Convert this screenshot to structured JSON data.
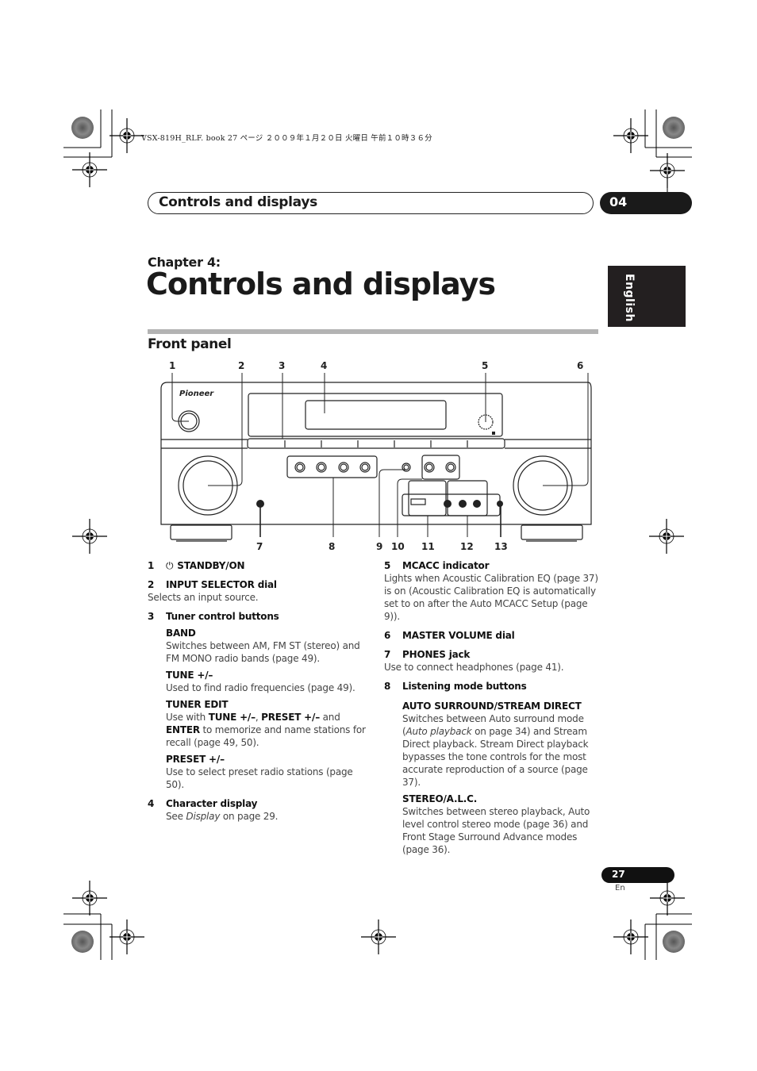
{
  "print_slug": "VSX-819H_RLF. book   27 ページ   ２００９年１月２０日   火曜日   午前１０時３６分",
  "header": {
    "title": "Controls and displays",
    "chapter_number": "04"
  },
  "language_tab": "English",
  "chapter": {
    "label": "Chapter 4:",
    "title": "Controls and displays"
  },
  "section": {
    "title": "Front panel"
  },
  "diagram": {
    "brand_logo": "Pioneer",
    "callouts_top": [
      "1",
      "2",
      "3",
      "4",
      "5",
      "6"
    ],
    "callouts_bottom": [
      "7",
      "8",
      "9",
      "10",
      "11",
      "12",
      "13"
    ]
  },
  "left_column": {
    "items": [
      {
        "num": "1",
        "icon": "power-icon",
        "glyph": "⏻",
        "title": "STANDBY/ON"
      },
      {
        "num": "2",
        "title": "INPUT SELECTOR dial",
        "desc": "Selects an input source."
      },
      {
        "num": "3",
        "title": "Tuner control buttons"
      }
    ],
    "tuner_subitems": [
      {
        "title": "BAND",
        "desc": "Switches between AM, FM ST (stereo) and FM MONO radio bands (page 49)."
      },
      {
        "title": "TUNE +/–",
        "desc": "Used to find radio frequencies (page 49)."
      },
      {
        "title": "TUNER EDIT",
        "desc_parts": {
          "p1": "Use with ",
          "b1": "TUNE +/–",
          "p2": ", ",
          "b2": "PRESET +/–",
          "p3": "  and ",
          "b3": "ENTER",
          "p4": " to memorize and name stations for recall (page 49, 50)."
        }
      },
      {
        "title": "PRESET +/–",
        "desc": "Use to select preset radio stations (page 50)."
      }
    ],
    "item4": {
      "num": "4",
      "title": "Character display",
      "desc_pre": "See ",
      "desc_italic": "Display",
      "desc_post": " on page 29."
    }
  },
  "right_column": {
    "items": [
      {
        "num": "5",
        "title": "MCACC indicator",
        "desc": "Lights when Acoustic Calibration EQ (page 37) is on (Acoustic Calibration EQ is automatically set to on after the Auto MCACC Setup (page 9))."
      },
      {
        "num": "6",
        "title": "MASTER VOLUME dial"
      },
      {
        "num": "7",
        "title": "PHONES jack",
        "desc": "Use to connect headphones (page 41)."
      },
      {
        "num": "8",
        "title": "Listening mode buttons"
      }
    ],
    "listening_subitems": [
      {
        "title": "AUTO SURROUND/STREAM DIRECT",
        "desc_pre": "Switches between Auto surround mode (",
        "desc_italic": "Auto playback",
        "desc_post": " on page 34) and Stream Direct playback. Stream Direct playback bypasses the tone controls for the most accurate reproduction of a source (page 37)."
      },
      {
        "title": "STEREO/A.L.C.",
        "desc": "Switches between stereo playback, Auto level control stereo mode (page 36) and Front Stage Surround Advance modes (page 36)."
      }
    ]
  },
  "footer": {
    "page_number": "27",
    "page_lang": "En"
  }
}
